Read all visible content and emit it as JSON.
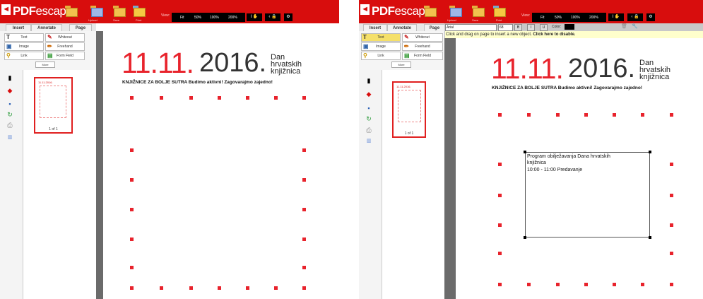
{
  "app": {
    "logo_text": "PDF",
    "logo_text2": "escape",
    "toolbar_labels": [
      "Upload",
      "Save",
      "Print"
    ],
    "view_label": "View:",
    "zoom_options": [
      "Fit",
      "50%",
      "100%",
      "200%"
    ],
    "tabs": [
      "Insert",
      "Annotate",
      "Page"
    ],
    "tools": [
      {
        "label": "Text",
        "icon": "text-icon"
      },
      {
        "label": "Whiteout",
        "icon": "whiteout-icon"
      },
      {
        "label": "Image",
        "icon": "image-icon"
      },
      {
        "label": "Freehand",
        "icon": "freehand-icon"
      },
      {
        "label": "Link",
        "icon": "link-icon"
      },
      {
        "label": "Form Field",
        "icon": "form-field-icon"
      }
    ],
    "more_label": "More",
    "page_count": "1 of 1"
  },
  "document": {
    "date_red": "11.11.",
    "date_year": "2016.",
    "event_title_lines": [
      "Dan",
      "hrvatskih",
      "knjižnica"
    ],
    "subtitle": "KNJIŽNICE ZA BOLJE SUTRA Budimo aktivni! Zagovarajmo zajedno!",
    "thumb_title": "11.11.2016."
  },
  "editor": {
    "font_family": "Arial",
    "font_size": "68",
    "format_buttons": [
      "B",
      "I",
      "U"
    ],
    "color_label": "Color:",
    "hint_text": "Click and drag on page to insert a new object.",
    "hint_link": "Click here to disable.",
    "textbox_lines": [
      "Program obilježavanja Dana hrvatskih",
      "knjižnica",
      "10:00 - 11:00 Predavanje"
    ]
  },
  "colors": {
    "brand_red": "#d80d0d",
    "accent_red": "#e8232c"
  }
}
